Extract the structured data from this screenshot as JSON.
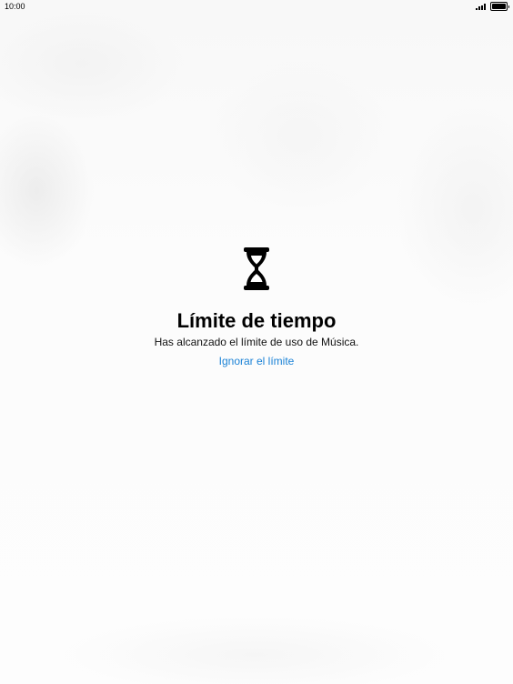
{
  "status_bar": {
    "time": "10:00"
  },
  "screen_time_block": {
    "icon": "hourglass-icon",
    "title": "Límite de tiempo",
    "message": "Has alcanzado el límite de uso de Música.",
    "ignore_label": "Ignorar el límite"
  },
  "colors": {
    "link": "#1a82d6",
    "text": "#000000",
    "background": "#fdfdfd"
  }
}
